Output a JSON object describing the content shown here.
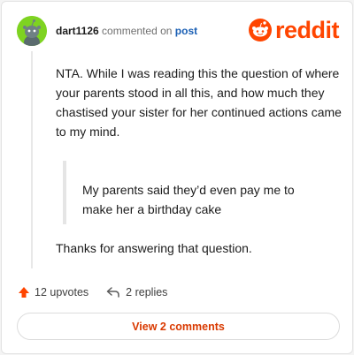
{
  "header": {
    "username": "dart1126",
    "action_text": "commented on",
    "post_link": "post"
  },
  "logo": {
    "wordmark": "reddit",
    "brand_color": "#ff4500"
  },
  "comment": {
    "paragraph_1": "NTA. While I was reading this the question of where your parents stood in all this, and how much they chastised your sister for her continued actions came to my mind.",
    "quote": "My parents said they’d even pay me to make her a birthday cake",
    "paragraph_2": "Thanks for answering that question."
  },
  "footer": {
    "upvotes": "12 upvotes",
    "replies": "2 replies",
    "upvote_icon": "arrow-up-icon",
    "reply_icon": "reply-arrow-icon"
  },
  "view_comments_label": "View 2 comments",
  "colors": {
    "accent": "#ff4500",
    "link": "#1a5fb4",
    "button_text": "#d93900",
    "avatar_bg": "#7ed321"
  }
}
